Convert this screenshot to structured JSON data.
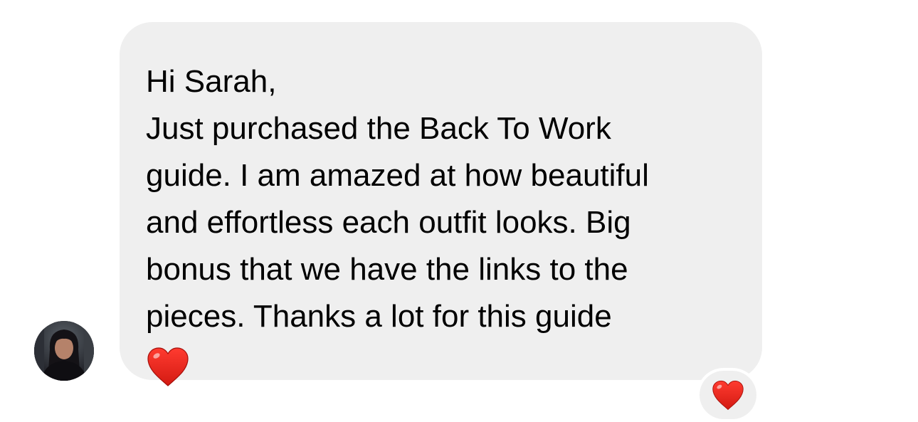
{
  "message": {
    "lines": [
      "Hi Sarah,",
      "Just purchased the Back To Work",
      "guide. I am amazed at how beautiful",
      "and effortless each outfit looks. Big",
      "bonus that we have the links to the",
      "pieces. Thanks a lot for this guide"
    ],
    "trailing_emoji": "heart-emoji"
  },
  "reaction": {
    "icon": "heart-emoji",
    "color": "#e0241b"
  },
  "sender": {
    "avatar": "avatar-photo"
  },
  "colors": {
    "bubble": "#efefef",
    "text": "#000000",
    "background": "#ffffff"
  }
}
